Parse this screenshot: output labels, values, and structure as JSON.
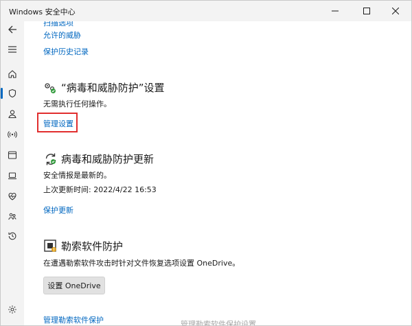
{
  "window": {
    "title": "Windows 安全中心"
  },
  "sidebar": {
    "icons": [
      "back-arrow-icon",
      "hamburger-menu-icon",
      "home-icon",
      "shield-icon",
      "person-icon",
      "wireless-icon",
      "app-browser-icon",
      "laptop-icon",
      "health-heart-icon",
      "family-icon",
      "history-icon",
      "gear-icon"
    ]
  },
  "links": {
    "scan_options": "扫描选项",
    "allowed_threats": "允许的威胁",
    "protection_history": "保护历史记录"
  },
  "virus_settings": {
    "title": "“病毒和威胁防护”设置",
    "text": "无需执行任何操作。",
    "link": "管理设置"
  },
  "virus_updates": {
    "title": "病毒和威胁防护更新",
    "text1": "安全情报是最新的。",
    "text2": "上次更新时间: 2022/4/22 16:53",
    "link": "保护更新"
  },
  "ransomware": {
    "title": "勒索软件防护",
    "text": "在遭遇勒索软件攻击时针对文件恢复选项设置 OneDrive。",
    "button": "设置 OneDrive",
    "link": "管理勒索软件保护"
  },
  "bottom_cut_text": "管理勒索软件保护设置"
}
